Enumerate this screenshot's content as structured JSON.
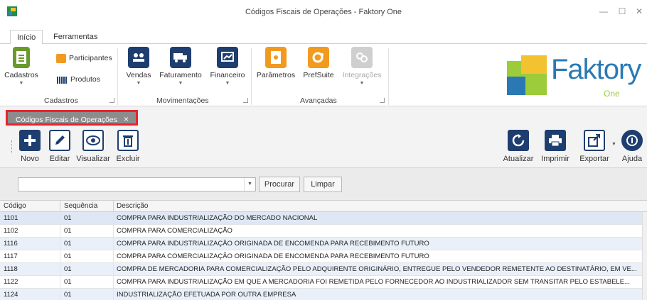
{
  "window": {
    "title": "Códigos Fiscais de Operações - Faktory One",
    "minimize": "—",
    "maximize": "☐",
    "close": "✕"
  },
  "ribbon_tabs": [
    {
      "label": "Início",
      "active": true
    },
    {
      "label": "Ferramentas",
      "active": false
    }
  ],
  "ribbon": {
    "cadastros": {
      "big_label": "Cadastros",
      "participantes": "Participantes",
      "produtos": "Produtos",
      "group_label": "Cadastros"
    },
    "movimentacoes": {
      "vendas": "Vendas",
      "faturamento": "Faturamento",
      "financeiro": "Financeiro",
      "group_label": "Movimentações"
    },
    "avancadas": {
      "parametros": "Parâmetros",
      "prefsuite": "PrefSuite",
      "integracoes": "Integrações",
      "group_label": "Avançadas"
    }
  },
  "brand": {
    "word": "Faktory",
    "sub": "One"
  },
  "doc_tab": {
    "label": "Códigos Fiscais de Operações",
    "close": "×"
  },
  "toolbar": {
    "novo": "Novo",
    "editar": "Editar",
    "visualizar": "Visualizar",
    "excluir": "Excluir",
    "atualizar": "Atualizar",
    "imprimir": "Imprimir",
    "exportar": "Exportar",
    "ajuda": "Ajuda"
  },
  "search": {
    "value": "",
    "procurar": "Procurar",
    "limpar": "Limpar"
  },
  "grid": {
    "headers": [
      "Código",
      "Sequência",
      "Descrição"
    ],
    "rows": [
      {
        "codigo": "1101",
        "sequencia": "01",
        "descricao": "COMPRA PARA INDUSTRIALIZAÇÃO DO MERCADO NACIONAL"
      },
      {
        "codigo": "1102",
        "sequencia": "01",
        "descricao": "COMPRA PARA COMERCIALIZAÇÃO"
      },
      {
        "codigo": "1116",
        "sequencia": "01",
        "descricao": "COMPRA PARA INDUSTRIALIZAÇÃO ORIGINADA DE ENCOMENDA PARA RECEBIMENTO FUTURO"
      },
      {
        "codigo": "1117",
        "sequencia": "01",
        "descricao": "COMPRA PARA COMERCIALIZAÇÃO ORIGINADA DE ENCOMENDA PARA RECEBIMENTO FUTURO"
      },
      {
        "codigo": "1118",
        "sequencia": "01",
        "descricao": "COMPRA DE MERCADORIA PARA COMERCIALIZAÇÃO PELO ADQUIRENTE ORIGINÁRIO, ENTREGUE PELO VENDEDOR REMETENTE AO DESTINATÁRIO, EM VE..."
      },
      {
        "codigo": "1122",
        "sequencia": "01",
        "descricao": "COMPRA PARA INDUSTRIALIZAÇÃO EM QUE A MERCADORIA FOI REMETIDA PELO FORNECEDOR AO INDUSTRIALIZADOR SEM TRANSITAR PELO ESTABELE..."
      },
      {
        "codigo": "1124",
        "sequencia": "01",
        "descricao": "INDUSTRIALIZAÇÃO EFETUADA POR OUTRA EMPRESA"
      }
    ]
  },
  "colors": {
    "navy": "#1f3e70",
    "orange": "#f29a1f",
    "highlight": "#e8232c",
    "brand_blue": "#2b79b4",
    "brand_green": "#9ccc3a"
  }
}
